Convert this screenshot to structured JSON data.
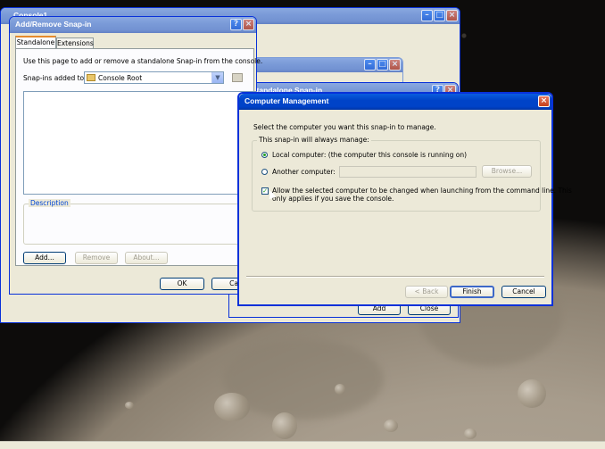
{
  "console_window": {
    "title": "Console1"
  },
  "add_remove_dialog": {
    "title": "Add/Remove Snap-in",
    "tabs": [
      "Standalone",
      "Extensions"
    ],
    "intro": "Use this page to add or remove a standalone Snap-in from the console.",
    "snapins_label": "Snap-ins added to:",
    "snapins_value": "Console Root",
    "description_label": "Description",
    "add_label": "Add...",
    "remove_label": "Remove",
    "about_label": "About...",
    "ok_label": "OK",
    "cancel_label": "Ca"
  },
  "add_standalone_dialog": {
    "title": "Add Standalone Snap-in",
    "add_label": "Add",
    "close_label": "Close"
  },
  "computer_management_dialog": {
    "title": "Computer Management",
    "instruction": "Select the computer you want this snap-in to manage.",
    "group_label": "This snap-in will always manage:",
    "local_computer": "Local computer:  (the computer this console is running on)",
    "another_computer": "Another computer:",
    "another_computer_value": "",
    "browse_label": "Browse...",
    "allow_change_line1": "Allow the selected computer to be changed when launching from the command line.  This",
    "allow_change_line2": "only applies if you save the console.",
    "back_label": "< Back",
    "finish_label": "Finish",
    "cancel_label": "Cancel"
  }
}
